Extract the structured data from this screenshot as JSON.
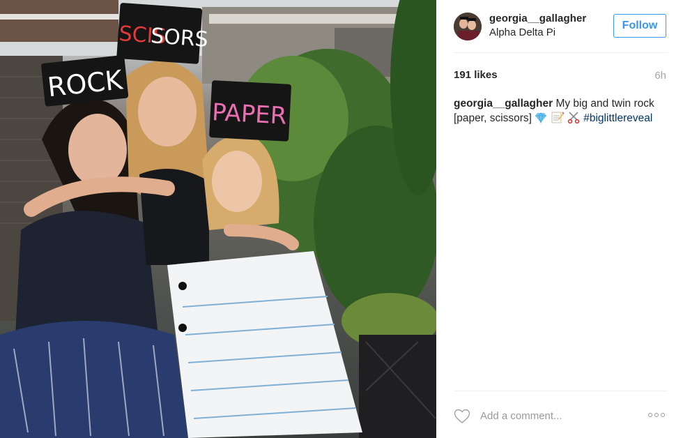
{
  "post": {
    "username": "georgia__gallagher",
    "location": "Alpha Delta Pi",
    "follow_label": "Follow",
    "likes": "191 likes",
    "time_ago": "6h"
  },
  "photo": {
    "sign_rock": "ROCK",
    "sign_scissors_red": "SCIS",
    "sign_scissors_white": "SORS",
    "sign_paper": "PAPER"
  },
  "caption": {
    "username": "georgia__gallagher",
    "text": "My big and twin rock [paper, scissors]",
    "emojis": [
      "gem-emoji",
      "memo-emoji",
      "scissors-emoji"
    ],
    "hashtag": "#biglittlereveal"
  },
  "comment": {
    "placeholder": "Add a comment..."
  },
  "icons": {
    "like": "heart-outline-icon",
    "more": "more-options-icon"
  },
  "colors": {
    "accent": "#3897f0",
    "hashtag": "#003569",
    "muted": "#a5a7aa",
    "text": "#262626"
  }
}
